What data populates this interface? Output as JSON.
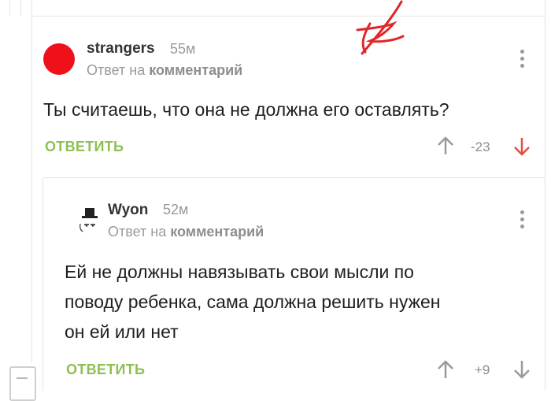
{
  "comments": [
    {
      "username": "strangers",
      "time": "55м",
      "reply_prefix": "Ответ на",
      "reply_target": "комментарий",
      "text": "Ты считаешь, что она не должна его оставлять?",
      "reply_label": "ОТВЕТИТЬ",
      "score": "-23",
      "colors": {
        "down_active": "#e74c3c"
      }
    },
    {
      "username": "Wyon",
      "time": "52м",
      "reply_prefix": "Ответ на",
      "reply_target": "комментарий",
      "text_lines": [
        "Ей не должны навязывать свои мысли по",
        "поводу ребенка, сама должна решить нужен",
        "он ей или нет"
      ],
      "reply_label": "ОТВЕТИТЬ",
      "score": "+9"
    }
  ],
  "icons": [
    "avatar-red-circle",
    "avatar-hat-face-icon",
    "kebab-menu-icon",
    "arrow-up-icon",
    "arrow-down-icon",
    "collapse-icon"
  ],
  "colors": {
    "accent_green": "#8cc152",
    "avatar_red": "#f0101a",
    "scribble_red": "#e0262a"
  }
}
